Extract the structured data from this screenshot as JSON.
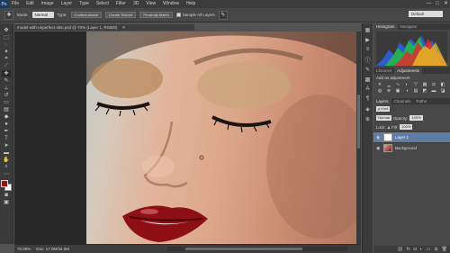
{
  "app": {
    "logo": "Ps"
  },
  "menu": [
    "File",
    "Edit",
    "Image",
    "Layer",
    "Type",
    "Select",
    "Filter",
    "3D",
    "View",
    "Window",
    "Help"
  ],
  "window_controls": [
    "—",
    "□",
    "✕"
  ],
  "options": {
    "mode_label": "Mode:",
    "mode_value": "Normal",
    "type_label": "Type:",
    "type_buttons": [
      "Content-Aware",
      "Create Texture",
      "Proximity Match"
    ],
    "sample_label": "Sample All Layers",
    "workspace": "Default"
  },
  "document": {
    "tab_title": "model-with-unperfect-skin.psd @ 70% (Layer 1, RGB/8)"
  },
  "status": {
    "zoom": "70.09%",
    "doc_size": "Doc: 17.0M/34.0M"
  },
  "panels": {
    "top_tabs": [
      "Histogram",
      "Navigator"
    ],
    "adj_tabs": [
      "Libraries",
      "Adjustments"
    ],
    "adj_title": "Add an adjustment",
    "layer_tabs": [
      "Layers",
      "Channels",
      "Paths"
    ],
    "blend_mode": "Normal",
    "opacity_label": "Opacity:",
    "opacity_value": "100%",
    "fill_label": "Fill:",
    "fill_value": "100%",
    "kind_label": "ρ Kind",
    "lock_label": "Lock:",
    "layers": [
      {
        "name": "Layer 1",
        "selected": true
      },
      {
        "name": "Background",
        "selected": false
      }
    ]
  },
  "colors": {
    "foreground": "#9e0f12",
    "background": "#ffffff",
    "selected_layer": "#5f7ca3"
  }
}
